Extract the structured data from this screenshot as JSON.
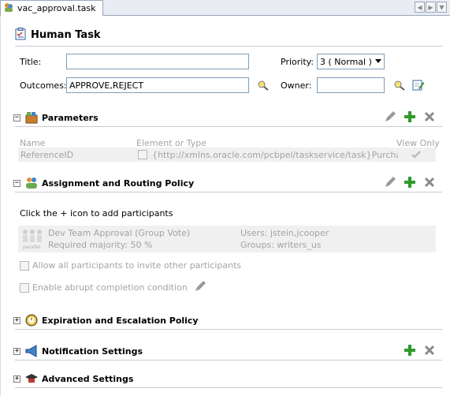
{
  "tab": {
    "label": "vac_approval.task"
  },
  "header": {
    "title": "Human Task"
  },
  "form": {
    "title_label": "Title:",
    "title_value": "",
    "outcomes_label": "Outcomes:",
    "outcomes_value": "APPROVE,REJECT",
    "priority_label": "Priority:",
    "priority_value": "3 ( Normal )",
    "owner_label": "Owner:",
    "owner_value": ""
  },
  "parameters": {
    "title": "Parameters",
    "col_name": "Name",
    "col_element": "Element or Type",
    "col_view_only": "View Only",
    "rows": [
      {
        "name": "ReferenceID",
        "type": "{http://xmlns.oracle.com/pcbpel/taskservice/task}PurchaseO..."
      }
    ]
  },
  "assignment": {
    "title": "Assignment and Routing Policy",
    "hint": "Click the + icon to add participants",
    "participant": {
      "icon_caption": "parallel",
      "name": "Dev Team Approval (Group Vote)",
      "majority": "Required majority: 50 %",
      "users": "Users: jstein,jcooper",
      "groups": "Groups: writers_us"
    },
    "allow_invite_label": "Allow all participants to invite other participants",
    "abrupt_label": "Enable abrupt completion condition"
  },
  "expiration": {
    "title": "Expiration and Escalation Policy"
  },
  "notification": {
    "title": "Notification Settings"
  },
  "advanced": {
    "title": "Advanced Settings"
  },
  "colors": {
    "accent_green": "#2f9a2a",
    "grey_icon": "#8a8a8a",
    "rule": "#c6cbd4"
  }
}
